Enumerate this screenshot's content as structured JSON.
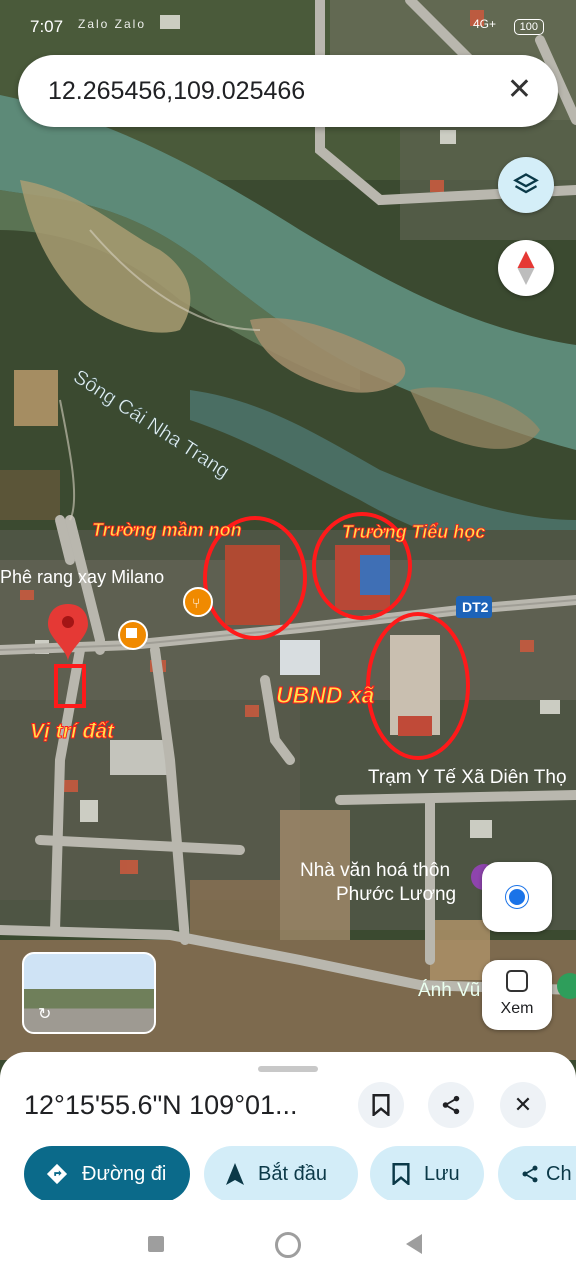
{
  "status": {
    "time": "7:07",
    "apps": "Zalo Zalo",
    "battery": "100",
    "signal": "4G+"
  },
  "search": {
    "query": "12.265456,109.025466"
  },
  "map": {
    "river_label": "Sông Cái Nha Trang",
    "cafe_label": "Phê rang xay Milano",
    "road_badge": "DT2",
    "health_label": "Trạm Y Tế Xã Diên Thọ",
    "culture_label_1": "Nhà văn hoá thôn",
    "culture_label_2": "Phước Lương",
    "place_label": "Ánh Vũ",
    "annotations": {
      "kindergarten": "Trường mầm non",
      "primary_school": "Trường Tiểu học",
      "commune_office": "UBND xã",
      "land_location": "Vị trí đất"
    },
    "colors": {
      "annotation": "#ff1a1a",
      "annotation_text": "#ffe14d",
      "pin": "#e53935"
    }
  },
  "view_button": {
    "label": "Xem"
  },
  "sheet": {
    "coordinates": "12°15'55.6\"N 109°01...",
    "actions": [
      {
        "label": "Đường đi",
        "icon": "directions-icon"
      },
      {
        "label": "Bắt đầu",
        "icon": "navigation-icon"
      },
      {
        "label": "Lưu",
        "icon": "bookmark-icon"
      },
      {
        "label": "Ch",
        "icon": "share-icon"
      }
    ],
    "accent": "#0b6a8a",
    "chip_bg": "#d3edf8"
  }
}
